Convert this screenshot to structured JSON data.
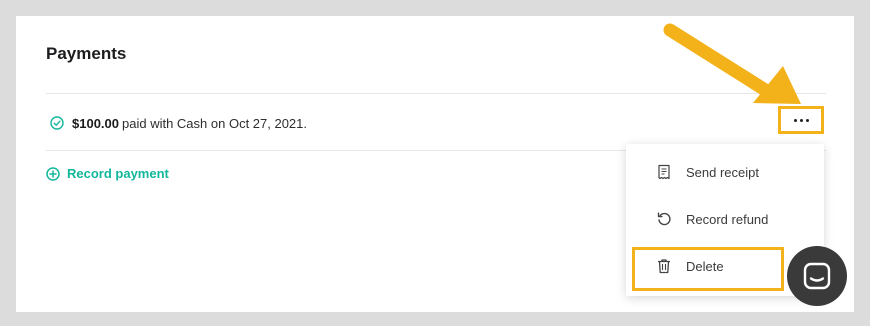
{
  "section": {
    "title": "Payments"
  },
  "payment": {
    "amount": "$100.00",
    "description": "paid with Cash on Oct 27, 2021.",
    "status_icon": "check-circle-icon"
  },
  "actions": {
    "record_payment_label": "Record payment",
    "record_payment_icon": "plus-circle-icon",
    "more_icon": "ellipsis-icon"
  },
  "menu": {
    "items": [
      {
        "label": "Send receipt",
        "icon": "receipt-icon"
      },
      {
        "label": "Record refund",
        "icon": "undo-icon"
      },
      {
        "label": "Delete",
        "icon": "trash-icon"
      }
    ]
  },
  "chat": {
    "icon": "chat-icon"
  },
  "colors": {
    "accent": "#13b79c",
    "highlight": "#f4b21a",
    "chat_bg": "#3a3a3a"
  }
}
